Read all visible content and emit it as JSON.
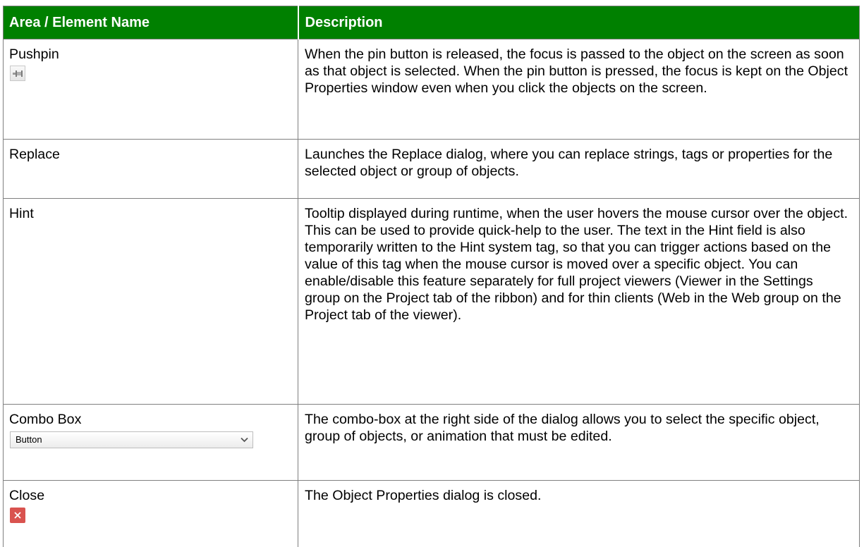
{
  "header": {
    "col1": "Area / Element Name",
    "col2": "Description"
  },
  "rows": [
    {
      "name": "Pushpin",
      "icon": "pushpin-icon",
      "description": "When the pin button is released, the focus is passed to the object on the screen as soon as that object is selected. When the pin button is pressed, the focus is kept on the Object Properties window even when you click the objects on the screen."
    },
    {
      "name": "Replace",
      "description": "Launches the Replace dialog, where you can replace strings, tags or properties for the selected object or group of objects."
    },
    {
      "name": "Hint",
      "description": "Tooltip displayed during runtime, when the user hovers the mouse cursor over the object. This can be used to provide quick-help to the user. The text in the Hint field is also temporarily written to the Hint system tag, so that you can trigger actions based on the value of this tag when the mouse cursor is moved over a specific object. You can enable/disable this feature separately for full project viewers (Viewer in the Settings group on the Project tab of the ribbon) and for thin clients (Web in the Web group on the Project tab of the viewer)."
    },
    {
      "name": "Combo Box",
      "combo_value": "Button",
      "icon": "chevron-down-icon",
      "description": "The combo-box at the right side of the dialog allows you to select the specific object, group of objects, or animation that must be edited."
    },
    {
      "name": "Close",
      "icon": "close-icon",
      "description": "The Object Properties dialog is closed."
    }
  ],
  "colors": {
    "header_bg": "#008000",
    "header_text": "#ffffff",
    "border": "#7f7f7f",
    "close_icon_bg": "#d9534f"
  }
}
